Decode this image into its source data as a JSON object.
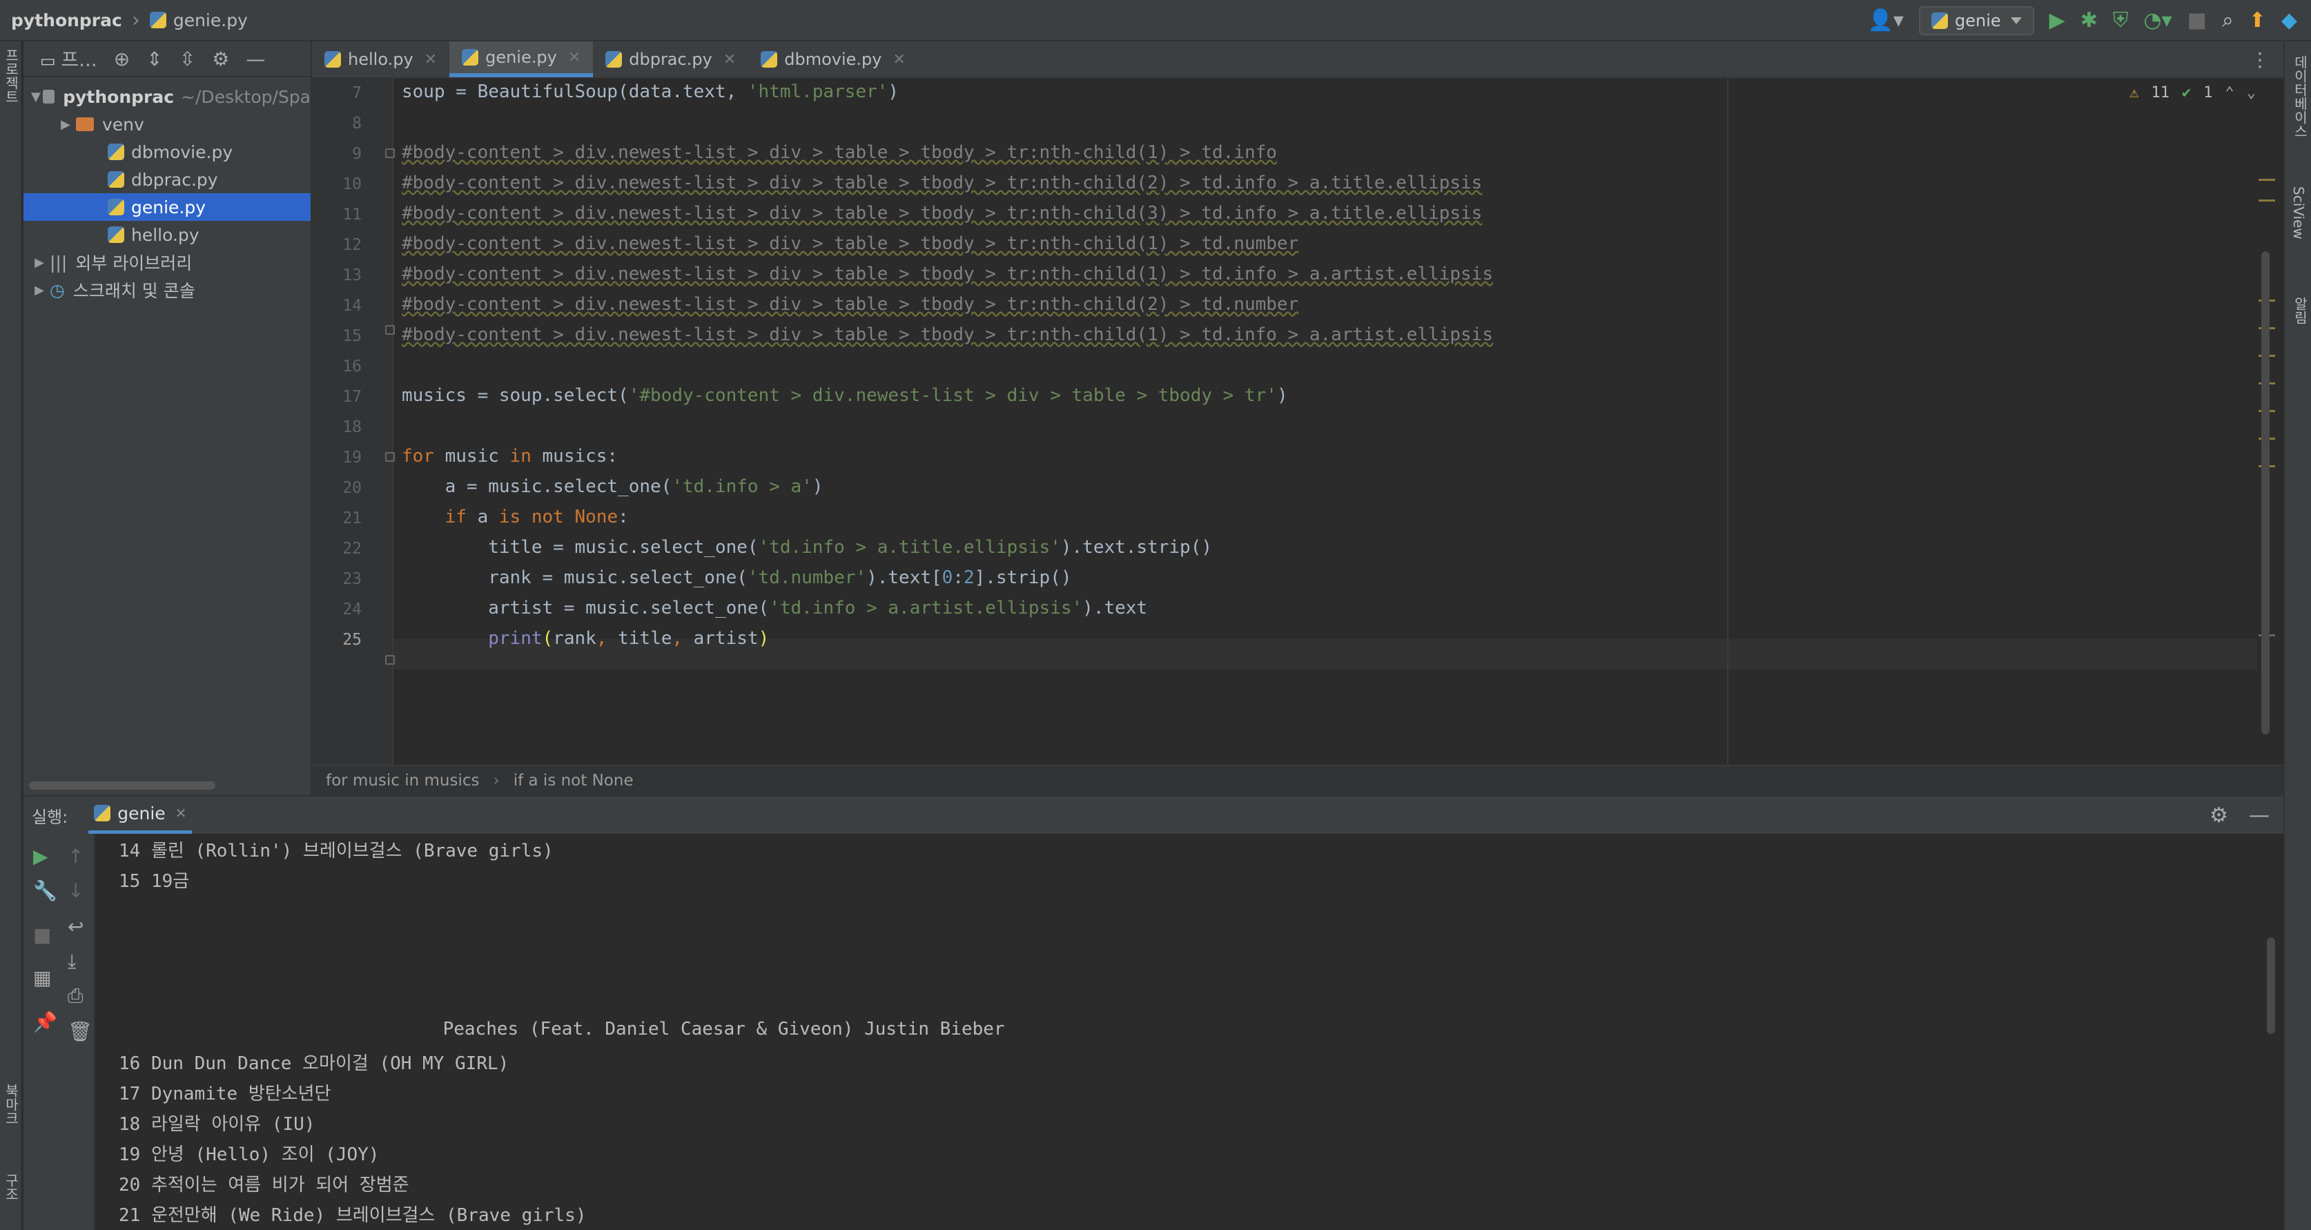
{
  "titlebar": {
    "project": "pythonprac",
    "file": "genie.py",
    "run_config": "genie"
  },
  "left_strip": {
    "project_label": "프로젝트",
    "bookmarks_label": "북마크",
    "structure_label": "구조"
  },
  "right_strip": {
    "database_label": "데이터베이스",
    "sciview_label": "SciView",
    "notifications_label": "알림"
  },
  "project_panel": {
    "title": "프...",
    "root": {
      "name": "pythonprac",
      "path": "~/Desktop/Spa"
    },
    "items": [
      {
        "name": "venv",
        "type": "folder"
      },
      {
        "name": "dbmovie.py",
        "type": "file"
      },
      {
        "name": "dbprac.py",
        "type": "file"
      },
      {
        "name": "genie.py",
        "type": "file",
        "selected": true
      },
      {
        "name": "hello.py",
        "type": "file"
      },
      {
        "name": "외부 라이브러리",
        "type": "library"
      },
      {
        "name": "스크래치 및 콘솔",
        "type": "scratch"
      }
    ]
  },
  "tabs": [
    {
      "label": "hello.py"
    },
    {
      "label": "genie.py",
      "active": true
    },
    {
      "label": "dbprac.py"
    },
    {
      "label": "dbmovie.py"
    }
  ],
  "inspections": {
    "warnings": "11",
    "ok": "1"
  },
  "editor": {
    "line_numbers": [
      "7",
      "8",
      "9",
      "10",
      "11",
      "12",
      "13",
      "14",
      "15",
      "16",
      "17",
      "18",
      "19",
      "20",
      "21",
      "22",
      "23",
      "24",
      "25"
    ],
    "current_line": "25"
  },
  "breadcrumb": [
    "for music in musics",
    "if a is not None"
  ],
  "run_panel": {
    "label": "실행:",
    "tab": "genie",
    "output": [
      "14 롤린 (Rollin') 브레이브걸스 (Brave girls)",
      "15 19금",
      "",
      "",
      "",
      "",
      "                              Peaches (Feat. Daniel Caesar & Giveon) Justin Bieber",
      "16 Dun Dun Dance 오마이걸 (OH MY GIRL)",
      "17 Dynamite 방탄소년단",
      "18 라일락 아이유 (IU)",
      "19 안녕 (Hello) 조이 (JOY)",
      "20 추적이는 여름 비가 되어 장범준",
      "21 운전만해 (We Ride) 브레이브걸스 (Brave girls)"
    ]
  },
  "icons": {
    "run": "play-icon",
    "debug": "bug-icon",
    "coverage": "shield-icon",
    "profile": "profile-icon",
    "stop": "stop-icon",
    "search": "search-icon",
    "update": "update-icon",
    "settings": "gear-icon"
  },
  "colors": {
    "accent": "#4a88c7",
    "selection": "#2f65ca",
    "run_green": "#59a869",
    "update": "#f0a732"
  }
}
